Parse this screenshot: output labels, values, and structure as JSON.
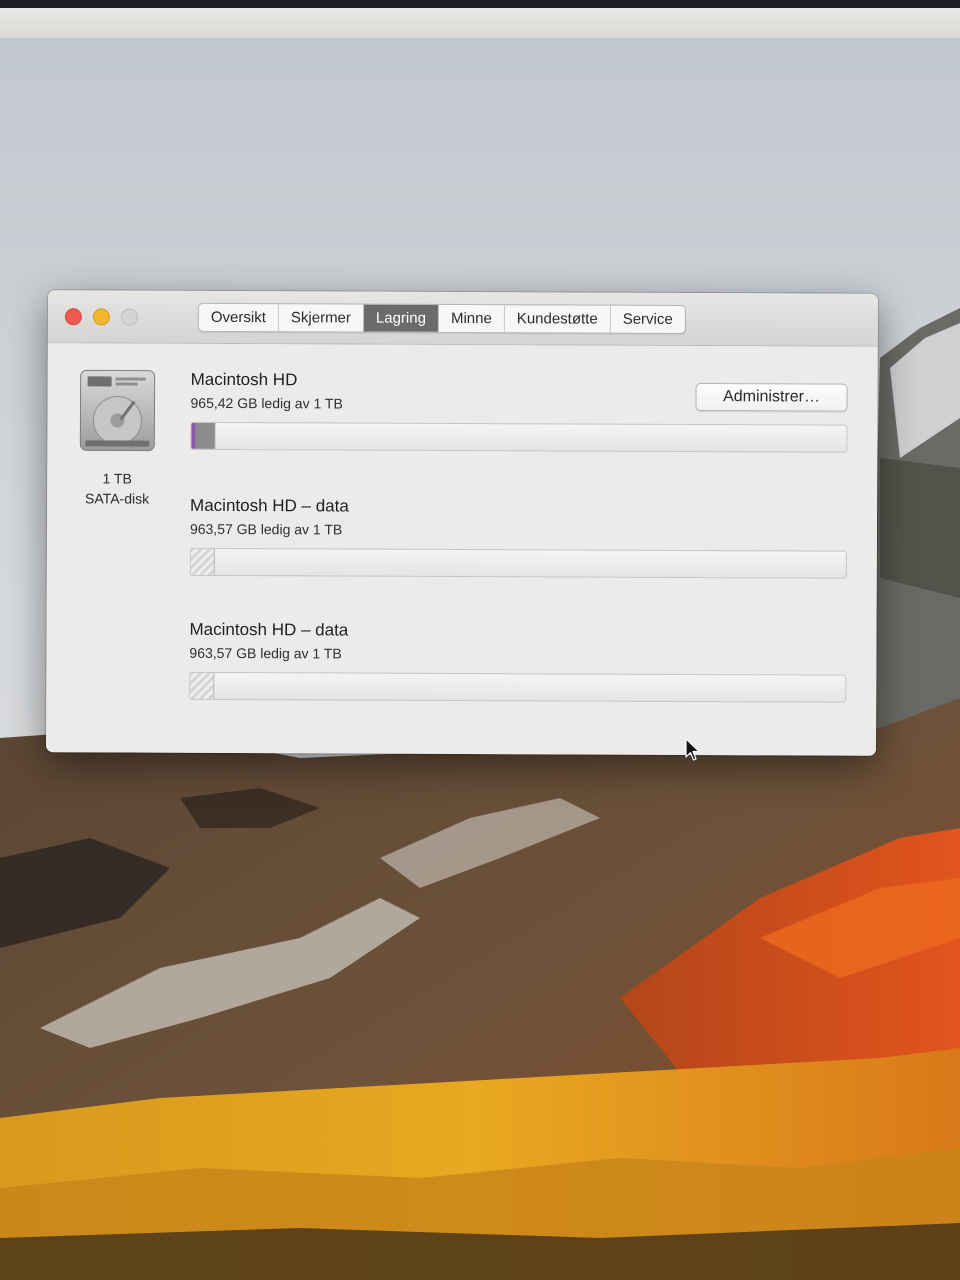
{
  "tabs": [
    {
      "label": "Oversikt",
      "active": false
    },
    {
      "label": "Skjermer",
      "active": false
    },
    {
      "label": "Lagring",
      "active": true
    },
    {
      "label": "Minne",
      "active": false
    },
    {
      "label": "Kundestøtte",
      "active": false
    },
    {
      "label": "Service",
      "active": false
    }
  ],
  "disk": {
    "icon": "hard-drive-icon",
    "size": "1 TB",
    "type": "SATA-disk"
  },
  "manage_button": "Administrer…",
  "volumes": [
    {
      "name": "Macintosh HD",
      "info": "965,42 GB ledig av 1 TB",
      "used_fraction": 0.035
    },
    {
      "name": "Macintosh HD – data",
      "info": "963,57 GB ledig av 1 TB",
      "used_fraction": 0.035
    },
    {
      "name": "Macintosh HD – data",
      "info": "963,57 GB ledig av 1 TB",
      "used_fraction": 0.035
    }
  ],
  "colors": {
    "close": "#ee5a50",
    "minimize": "#f1b52e",
    "active_tab": "#6c6b6a",
    "system_segment": "#8a5aa8"
  }
}
